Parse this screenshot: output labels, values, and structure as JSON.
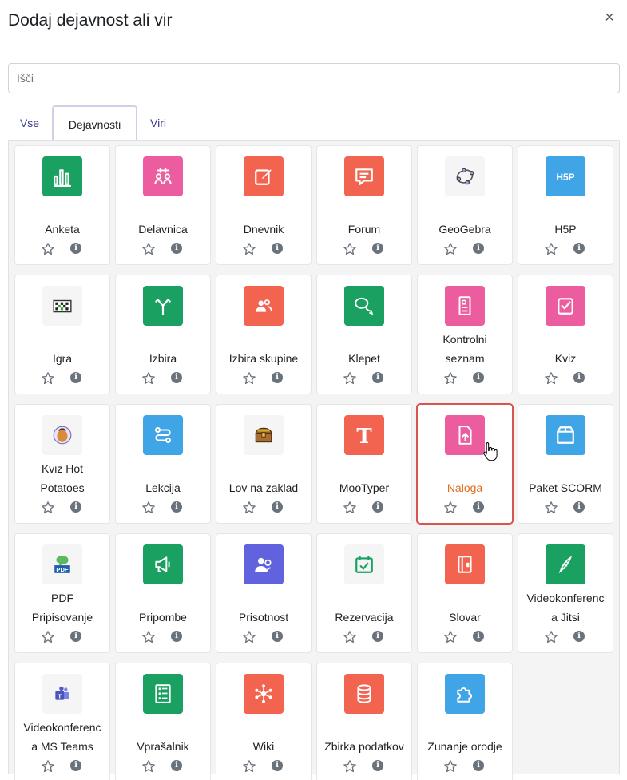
{
  "dialog": {
    "title": "Dodaj dejavnost ali vir",
    "close_glyph": "×"
  },
  "search": {
    "placeholder": "Išči"
  },
  "tabs": [
    "Vse",
    "Dejavnosti",
    "Viri"
  ],
  "active_tab": "Dejavnosti",
  "colors": {
    "green": "#1aa162",
    "pink": "#ec5d9f",
    "orange": "#f2644f",
    "blue": "#3fa5e6",
    "purple": "#6163de",
    "light": "#f5f5f5",
    "selection": "#d9534f",
    "highlight_text": "#e16b1a"
  },
  "activities": [
    {
      "name": "Anketa",
      "icon": "poll-chart-icon",
      "color": "#1aa162"
    },
    {
      "name": "Delavnica",
      "icon": "workshop-icon",
      "color": "#ec5d9f"
    },
    {
      "name": "Dnevnik",
      "icon": "journal-edit-icon",
      "color": "#f2644f"
    },
    {
      "name": "Forum",
      "icon": "forum-chat-icon",
      "color": "#f2644f"
    },
    {
      "name": "GeoGebra",
      "icon": "geogebra-icon",
      "color": "#f5f5f5"
    },
    {
      "name": "H5P",
      "icon": "h5p-icon",
      "color": "#3fa5e6"
    },
    {
      "name": "Igra",
      "icon": "game-board-icon",
      "color": "#f5f5f5"
    },
    {
      "name": "Izbira",
      "icon": "choice-arrows-icon",
      "color": "#1aa162"
    },
    {
      "name": "Izbira skupine",
      "icon": "group-choice-icon",
      "color": "#f2644f"
    },
    {
      "name": "Klepet",
      "icon": "chat-bubbles-icon",
      "color": "#1aa162"
    },
    {
      "name": "Kontrolni seznam",
      "icon": "checklist-icon",
      "color": "#ec5d9f"
    },
    {
      "name": "Kviz",
      "icon": "quiz-check-icon",
      "color": "#ec5d9f"
    },
    {
      "name": "Kviz Hot Potatoes",
      "icon": "hot-potatoes-icon",
      "color": "#f5f5f5"
    },
    {
      "name": "Lekcija",
      "icon": "lesson-path-icon",
      "color": "#3fa5e6"
    },
    {
      "name": "Lov na zaklad",
      "icon": "treasure-chest-icon",
      "color": "#f5f5f5"
    },
    {
      "name": "MooTyper",
      "icon": "mootyper-t-icon",
      "color": "#f2644f"
    },
    {
      "name": "Naloga",
      "icon": "assignment-upload-icon",
      "color": "#ec5d9f"
    },
    {
      "name": "Paket SCORM",
      "icon": "scorm-package-icon",
      "color": "#3fa5e6"
    },
    {
      "name": "PDF Pripisovanje",
      "icon": "pdf-annotation-icon",
      "color": "#f5f5f5"
    },
    {
      "name": "Pripombe",
      "icon": "feedback-megaphone-icon",
      "color": "#1aa162"
    },
    {
      "name": "Prisotnost",
      "icon": "attendance-users-icon",
      "color": "#6163de"
    },
    {
      "name": "Rezervacija",
      "icon": "calendar-check-icon",
      "color": "#f5f5f5"
    },
    {
      "name": "Slovar",
      "icon": "glossary-book-icon",
      "color": "#f2644f"
    },
    {
      "name": "Videokonferenca Jitsi",
      "icon": "jitsi-icon",
      "color": "#1aa162"
    },
    {
      "name": "Videokonferenca MS Teams",
      "icon": "ms-teams-icon",
      "color": "#f5f5f5"
    },
    {
      "name": "Vprašalnik",
      "icon": "questionnaire-list-icon",
      "color": "#1aa162"
    },
    {
      "name": "Wiki",
      "icon": "wiki-network-icon",
      "color": "#f2644f"
    },
    {
      "name": "Zbirka podatkov",
      "icon": "database-icon",
      "color": "#f2644f"
    },
    {
      "name": "Zunanje orodje",
      "icon": "external-tool-puzzle-icon",
      "color": "#3fa5e6"
    }
  ],
  "selected_activity": "Naloga",
  "label_lines": {
    "Kontrolni seznam": [
      "Kontrolni",
      "seznam"
    ],
    "Kviz Hot Potatoes": [
      "Kviz Hot",
      "Potatoes"
    ],
    "PDF Pripisovanje": [
      "PDF",
      "Pripisovanje"
    ],
    "Videokonferenca Jitsi": [
      "Videokonferenc",
      "a Jitsi"
    ],
    "Videokonferenca MS Teams": [
      "Videokonferenc",
      "a MS Teams"
    ]
  },
  "info_glyph": "i"
}
